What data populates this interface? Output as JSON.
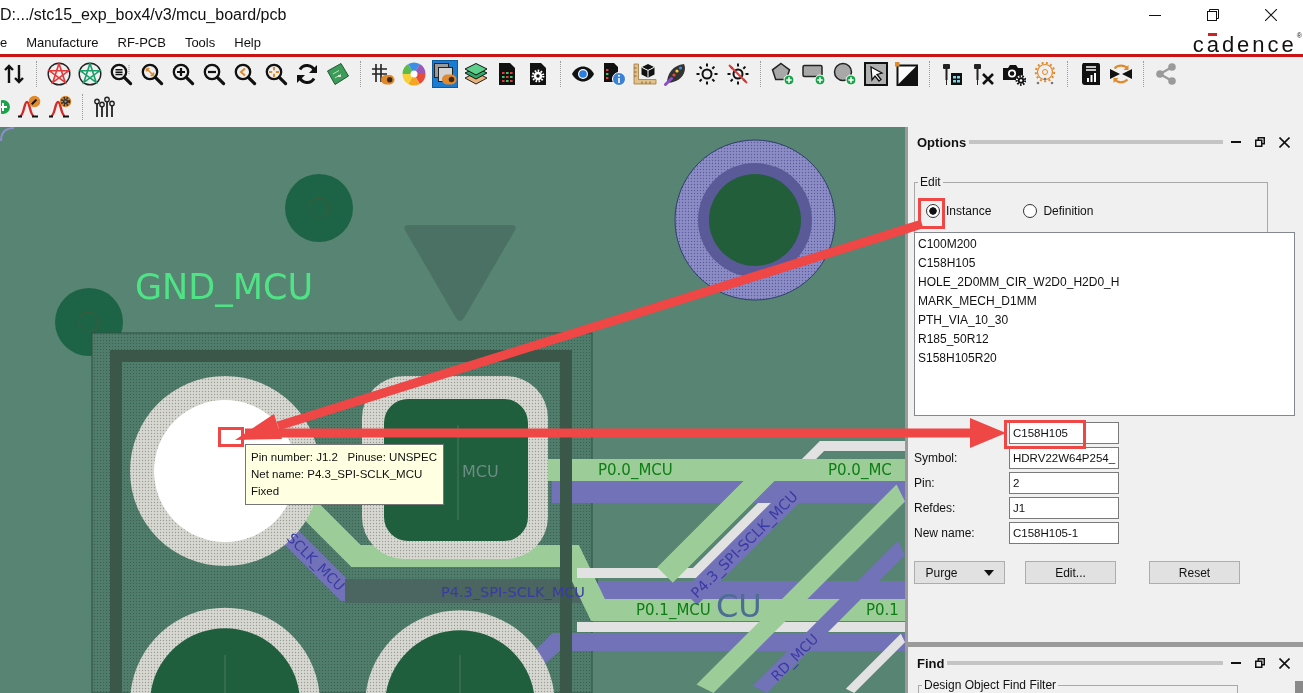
{
  "window": {
    "title": "D:.../stc15_exp_box4/v3/mcu_board/pcb"
  },
  "menu": [
    "e",
    "Manufacture",
    "RF-PCB",
    "Tools",
    "Help"
  ],
  "logo": {
    "text": "cadence",
    "mark": "®"
  },
  "toolbar": {
    "rows": [
      {
        "buttons": [
          {
            "pressed": false
          },
          {
            "pressed": false
          },
          {
            "pressed": false
          },
          {
            "pressed": false
          },
          {
            "pressed": false
          },
          {
            "pressed": false
          },
          {
            "pressed": false
          },
          {
            "pressed": false
          },
          {
            "pressed": false
          },
          {
            "pressed": false
          },
          {
            "pressed": false
          },
          {
            "pressed": false
          },
          {
            "pressed": false
          },
          {
            "pressed": true
          },
          {
            "pressed": false
          },
          {
            "pressed": false
          },
          {
            "pressed": false
          },
          {
            "pressed": false
          },
          {
            "pressed": false
          },
          {
            "pressed": false
          },
          {
            "pressed": false
          },
          {
            "pressed": false
          },
          {
            "pressed": false
          },
          {
            "pressed": false
          },
          {
            "pressed": false
          },
          {
            "pressed": false
          },
          {
            "pressed": false
          },
          {
            "pressed": false
          },
          {
            "pressed": false
          },
          {
            "pressed": false
          },
          {
            "pressed": false
          },
          {
            "pressed": false
          },
          {
            "pressed": false
          },
          {
            "pressed": false
          },
          {
            "pressed": false
          }
        ]
      },
      {
        "buttons": [
          {
            "pressed": false
          },
          {
            "pressed": false
          },
          {
            "pressed": false
          },
          {
            "pressed": false
          }
        ]
      }
    ]
  },
  "canvas": {
    "labels": [
      {
        "text": "GND_MCU"
      },
      {
        "text": "MCU"
      },
      {
        "text": "P0.0_MCU"
      },
      {
        "text": "P0.0_MC"
      },
      {
        "text": "P4.3_SPI-SCLK_MCU"
      },
      {
        "text": "SCLK_MCU"
      },
      {
        "text": "P4.3_SPI-SCLK_MCU"
      },
      {
        "text": "P0.1_MCU"
      },
      {
        "text": "CU"
      },
      {
        "text": "P0.1"
      },
      {
        "text": "RD_MCU"
      }
    ],
    "tooltip": [
      "Pin number: J1.2   Pinuse: UNSPEC",
      "Net name: P4.3_SPI-SCLK_MCU",
      "Fixed"
    ]
  },
  "options_panel": {
    "title": "Options",
    "edit_group": {
      "title": "Edit",
      "options": [
        {
          "label": "Instance",
          "selected": true
        },
        {
          "label": "Definition",
          "selected": false
        }
      ]
    },
    "symbols": [
      {
        "label": "C100M200",
        "selected": false
      },
      {
        "label": "C158H105",
        "selected": false
      },
      {
        "label": "HOLE_2D0MM_CIR_W2D0_H2D0_H",
        "selected": false
      },
      {
        "label": "MARK_MECH_D1MM",
        "selected": false
      },
      {
        "label": "PTH_VIA_10_30",
        "selected": false
      },
      {
        "label": "R185_50R12",
        "selected": false
      },
      {
        "label": "S158H105R20",
        "selected": false
      }
    ],
    "fields": [
      {
        "value": "C158H105"
      },
      {
        "label": "Symbol:",
        "value": "HDRV22W64P254_"
      },
      {
        "label": "Pin:",
        "value": "2"
      },
      {
        "label": "Refdes:",
        "value": "J1"
      },
      {
        "label": "New name:",
        "value": "C158H105-1"
      }
    ],
    "buttons": [
      {
        "label": "Purge",
        "kind": "dropdown"
      },
      {
        "label": "Edit...",
        "kind": "plain"
      },
      {
        "label": "Reset",
        "kind": "plain"
      }
    ]
  },
  "find_panel": {
    "title": "Find",
    "group_title": "Design Object Find Filter"
  }
}
